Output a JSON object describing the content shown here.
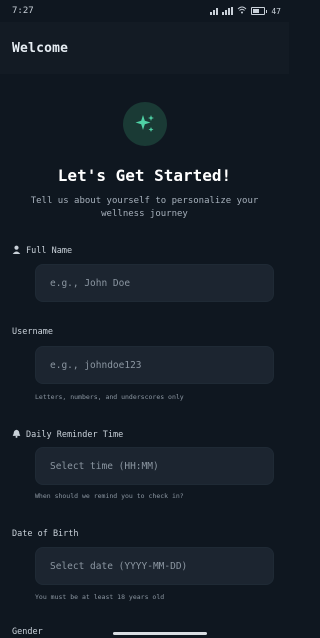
{
  "status_bar": {
    "time": "7:27",
    "network": "Vo\nWiFi",
    "battery": "47"
  },
  "header": {
    "title": "Welcome"
  },
  "hero": {
    "icon": "sparkles-icon",
    "accent": "#4fd1a5",
    "title": "Let's Get Started!",
    "subtitle": "Tell us about yourself to personalize your wellness journey"
  },
  "form": {
    "full_name": {
      "label": "Full Name",
      "placeholder": "e.g., John Doe"
    },
    "username": {
      "label": "Username",
      "placeholder": "e.g., johndoe123",
      "hint": "Letters, numbers, and underscores only"
    },
    "reminder": {
      "label": "Daily Reminder Time",
      "placeholder": "Select time (HH:MM)",
      "hint": "When should we remind you to check in?"
    },
    "dob": {
      "label": "Date of Birth",
      "placeholder": "Select date (YYYY-MM-DD)",
      "hint": "You must be at least 18 years old"
    },
    "gender": {
      "label": "Gender"
    }
  }
}
